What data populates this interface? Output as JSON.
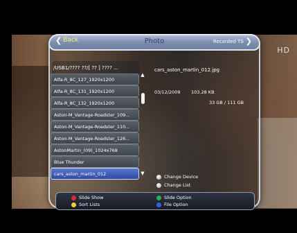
{
  "header": {
    "back_label": "Back",
    "title": "Photo",
    "right_label": "Recorded TS"
  },
  "overlay": {
    "badge": "HD"
  },
  "browser": {
    "path": "/USB1/???? ??/[  ?? ] ???? ...",
    "items": [
      "Alfa-R_8C_127_1920x1200",
      "Alfa-R_8C_131_1920x1200",
      "Alfa-R_8C_132_1920x1200",
      "Aston-M_Vantage-Roadster_109...",
      "Aston-M_Vantage-Roadster_110...",
      "Aston-M_Vantage-Roadster_126...",
      "AstonMartin_(09)_1024x768",
      "Blue Thunder",
      "cars_aston_martin_012"
    ],
    "selected_index": 8
  },
  "details": {
    "filename": "cars_aston_martin_012.jpg",
    "date": "03/12/2009",
    "filesize": "103.28 KB",
    "capacity": "33 GB / 111 GB"
  },
  "side_hints": {
    "change_device": "Change Device",
    "change_list": "Change List"
  },
  "bottom_hints": {
    "slide_show": "Slide Show",
    "slide_option": "Slide Option",
    "sort_lists": "Sort Lists",
    "file_option": "File Option"
  },
  "colors": {
    "red": "#d22f2f",
    "green": "#2fae4a",
    "yellow": "#e8d43a",
    "blue": "#2f63d6",
    "selection": "#2e49a6",
    "header": "#7e8eaf"
  }
}
